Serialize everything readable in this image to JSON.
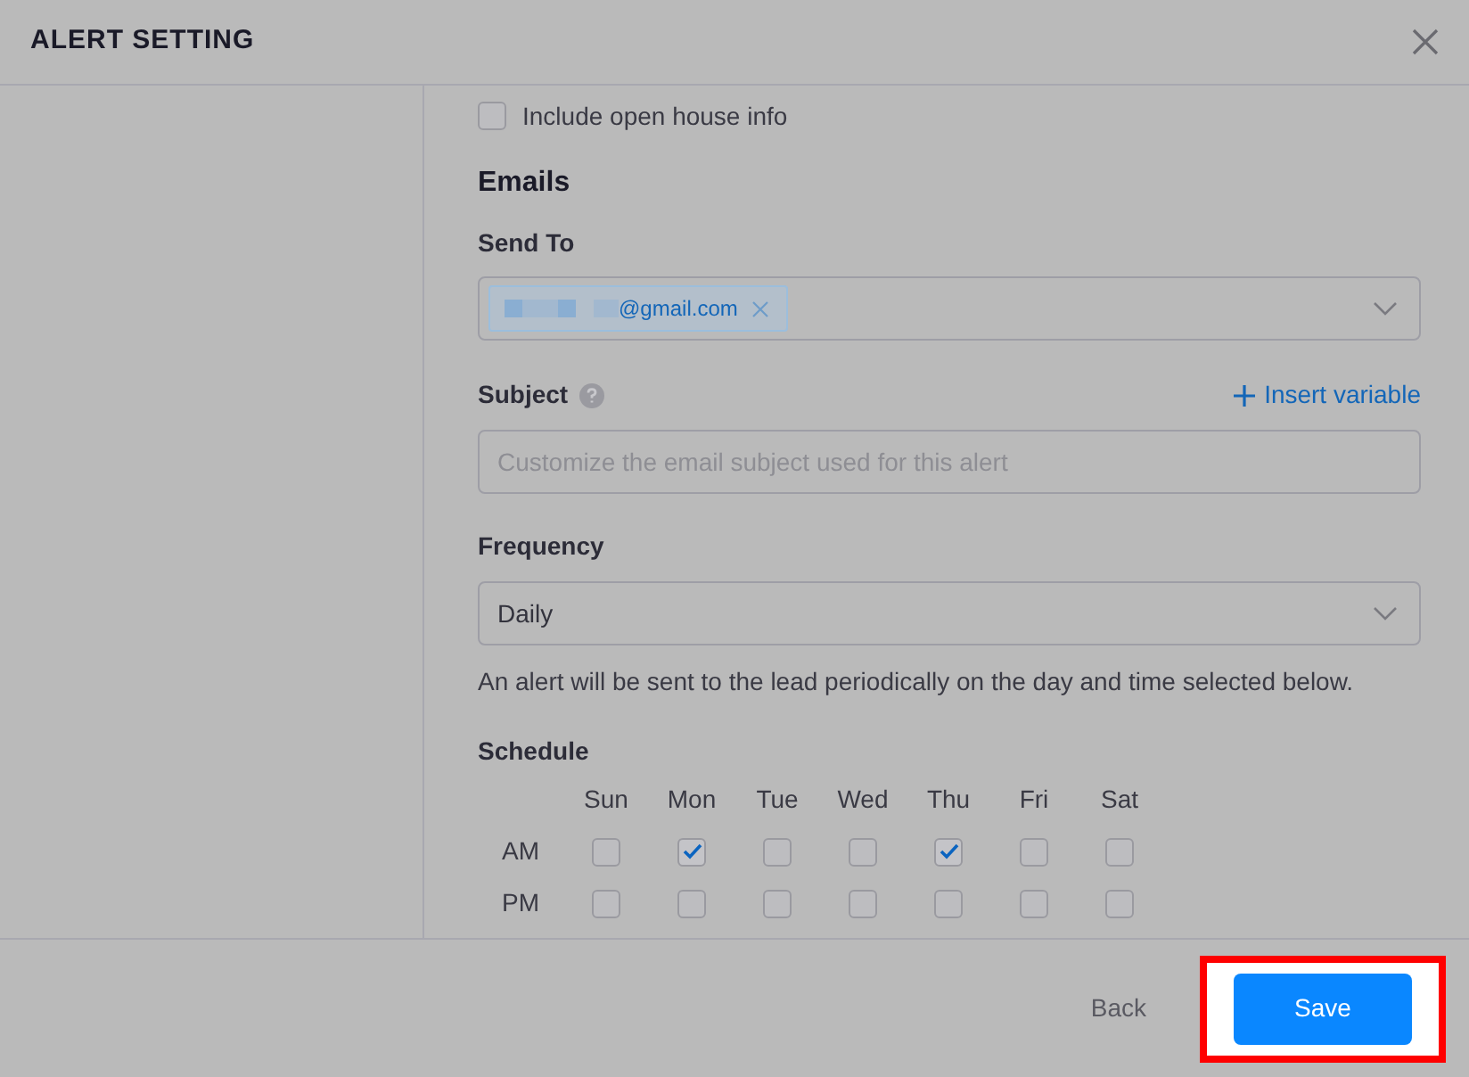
{
  "dialog": {
    "title": "ALERT SETTING"
  },
  "include_open_house": {
    "label": "Include open house info",
    "checked": false
  },
  "emails": {
    "heading": "Emails",
    "send_to": {
      "label": "Send To",
      "chips": [
        {
          "text": "@gmail.com",
          "redacted": true
        }
      ]
    },
    "subject": {
      "label": "Subject",
      "insert_link": "Insert variable",
      "placeholder": "Customize the email subject used for this alert"
    },
    "frequency": {
      "label": "Frequency",
      "value": "Daily",
      "hint": "An alert will be sent to the lead periodically on the day and time selected below."
    }
  },
  "schedule": {
    "label": "Schedule",
    "days": [
      "Sun",
      "Mon",
      "Tue",
      "Wed",
      "Thu",
      "Fri",
      "Sat"
    ],
    "rows": [
      {
        "label": "AM",
        "checked": [
          false,
          true,
          false,
          false,
          true,
          false,
          false
        ]
      },
      {
        "label": "PM",
        "checked": [
          false,
          false,
          false,
          false,
          false,
          false,
          false
        ]
      }
    ]
  },
  "footer": {
    "buttons": [
      {
        "label": "Back",
        "kind": "text",
        "highlighted": false
      },
      {
        "label": "Save",
        "kind": "primary",
        "highlighted": true
      }
    ]
  }
}
